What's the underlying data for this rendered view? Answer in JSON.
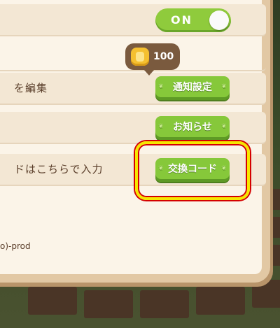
{
  "toggle": {
    "label": "ON",
    "state": "on"
  },
  "coin_badge": {
    "value": "100",
    "icon": "gold-coin-icon"
  },
  "rows": [
    {
      "label": "を編集",
      "button": "通知設定"
    },
    {
      "label": "",
      "button": "お知らせ"
    },
    {
      "label": "ドはこちらで入力",
      "button": "交換コード"
    }
  ],
  "footer": {
    "version_text": "o)-prod"
  },
  "colors": {
    "button_green": "#86c83a",
    "panel_bg": "#fbf4e8",
    "highlight": "#f6e600"
  }
}
